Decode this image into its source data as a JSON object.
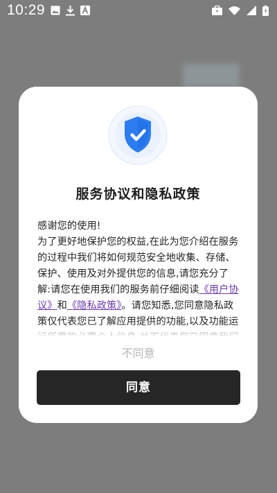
{
  "status_bar": {
    "time": "10:29",
    "left_icons": [
      "image-icon",
      "download-icon",
      "font-icon"
    ],
    "right_icons": [
      "briefcase-icon",
      "wifi-icon",
      "signal-icon",
      "battery-icon"
    ]
  },
  "dialog": {
    "title": "服务协议和隐私政策",
    "greeting": "感谢您的使用!",
    "body_1": "为了更好地保护您的权益,在此为您介绍在服务的过程中我们将如何规范安全地收集、存储、保护、使用及对外提供您的信息,请您充分了解:请您在使用我们的服务前仔细阅读",
    "link_user_agreement": "《用户协议》",
    "and_text": "和",
    "link_privacy_policy": "《隐私政策》",
    "body_2": "。请您知悉,您同意隐私政策仅代表您已了解应用提供的功能,以及功能运行所需的必要个人信息,并不代表您已同意我们可以收集非必要个人信息。",
    "disagree_label": "不同意",
    "agree_label": "同意"
  },
  "colors": {
    "overlay": "#7d7d7d",
    "dialog_bg": "#ffffff",
    "link": "#6a3ab2",
    "agree_bg": "#262626",
    "disagree_text": "#b4b4b4",
    "shield_blue": "#2c7df2"
  }
}
